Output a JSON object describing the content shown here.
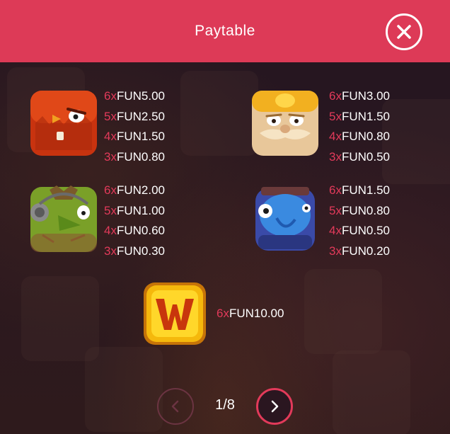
{
  "header": {
    "title": "Paytable"
  },
  "colors": {
    "header": "#dd3a57",
    "count": "#e23a5a",
    "amount": "#ffffff"
  },
  "symbols": [
    {
      "name": "red-owl-symbol",
      "pays": [
        {
          "count": "6x",
          "amount": "FUN5.00"
        },
        {
          "count": "5x",
          "amount": "FUN2.50"
        },
        {
          "count": "4x",
          "amount": "FUN1.50"
        },
        {
          "count": "3x",
          "amount": "FUN0.80"
        }
      ]
    },
    {
      "name": "gold-mustache-symbol",
      "pays": [
        {
          "count": "6x",
          "amount": "FUN3.00"
        },
        {
          "count": "5x",
          "amount": "FUN1.50"
        },
        {
          "count": "4x",
          "amount": "FUN0.80"
        },
        {
          "count": "3x",
          "amount": "FUN0.50"
        }
      ]
    },
    {
      "name": "green-headphones-symbol",
      "pays": [
        {
          "count": "6x",
          "amount": "FUN2.00"
        },
        {
          "count": "5x",
          "amount": "FUN1.00"
        },
        {
          "count": "4x",
          "amount": "FUN0.60"
        },
        {
          "count": "3x",
          "amount": "FUN0.30"
        }
      ]
    },
    {
      "name": "blue-creature-symbol",
      "pays": [
        {
          "count": "6x",
          "amount": "FUN1.50"
        },
        {
          "count": "5x",
          "amount": "FUN0.80"
        },
        {
          "count": "4x",
          "amount": "FUN0.50"
        },
        {
          "count": "3x",
          "amount": "FUN0.20"
        }
      ]
    },
    {
      "name": "wild-symbol",
      "pays": [
        {
          "count": "6x",
          "amount": "FUN10.00"
        }
      ]
    }
  ],
  "pagination": {
    "current": "1/8"
  }
}
